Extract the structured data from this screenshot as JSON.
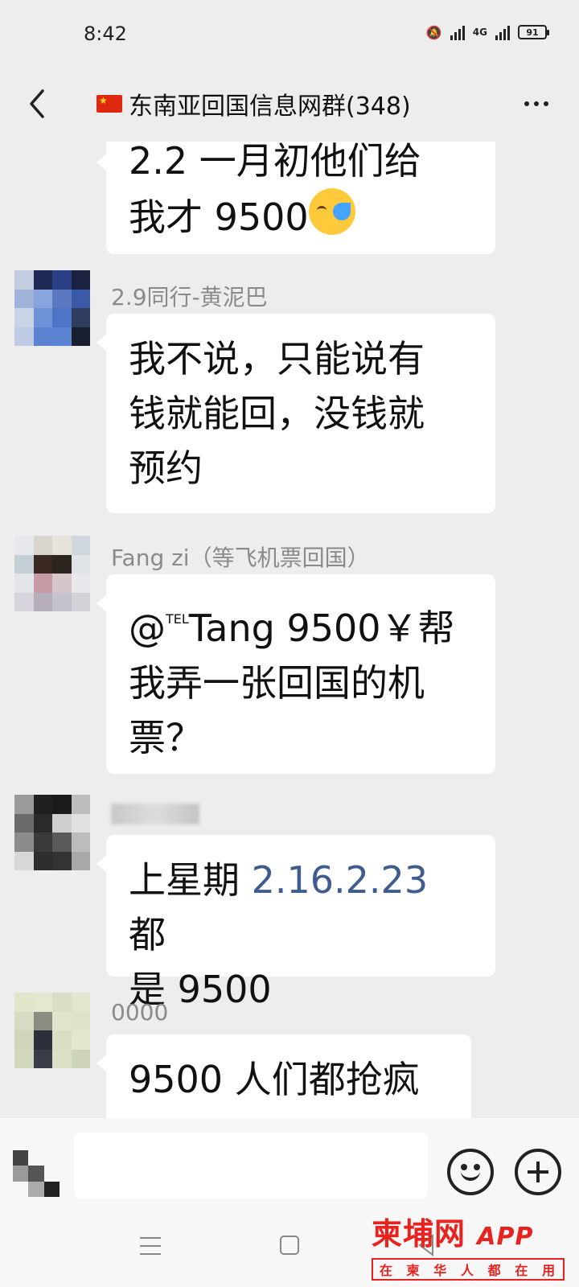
{
  "status_bar": {
    "time": "8:42",
    "network": "4G",
    "battery": "91"
  },
  "header": {
    "title": "东南亚回国信息网群(348)"
  },
  "messages": [
    {
      "sender": "",
      "lines": [
        "2.2 一月初他们给",
        "我才 9500"
      ],
      "emoji": "face-with-tears-of-joy-icon"
    },
    {
      "sender": "2.9同行-黄泥巴",
      "lines": [
        "我不说，只能说有",
        "钱就能回，没钱就",
        "预约"
      ]
    },
    {
      "sender": "Fang zi（等飞机票回国）",
      "mention": "@",
      "mention_sup": "TEL",
      "lines": [
        "Tang 9500￥帮",
        "我弄一张回国的机",
        "票？"
      ]
    },
    {
      "sender": "",
      "line1_prefix": "上星期",
      "line1_link": "2.16.2.23",
      "line1_suffix": "都",
      "line2": "是 9500"
    },
    {
      "sender": "0000",
      "lines": [
        "9500 人们都抢疯"
      ]
    }
  ],
  "watermark": {
    "brand": "柬埔网",
    "app": "APP",
    "slogan": [
      "在",
      "柬",
      "华",
      "人",
      "都",
      "在",
      "用"
    ]
  },
  "colors": {
    "background": "#ededed",
    "bubble": "#ffffff",
    "link": "#3f5c8f",
    "watermark": "#e8231f"
  }
}
